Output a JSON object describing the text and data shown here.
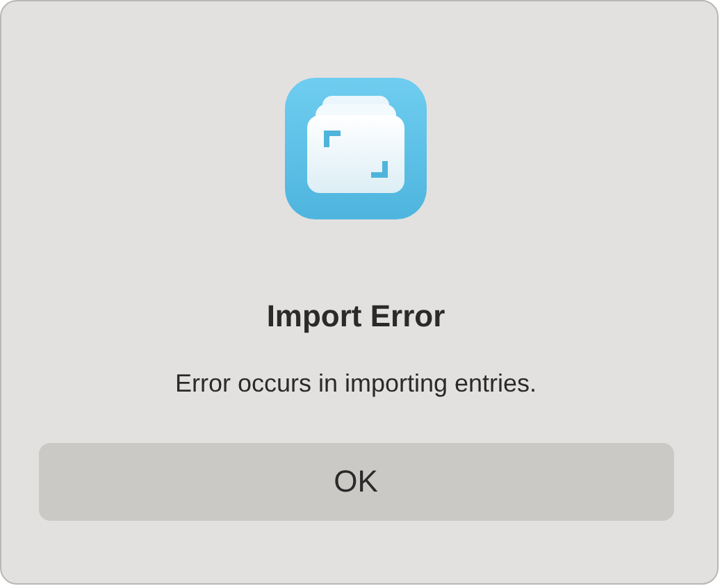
{
  "dialog": {
    "title": "Import Error",
    "message": "Error occurs in importing entries.",
    "button": {
      "label": "OK"
    }
  }
}
